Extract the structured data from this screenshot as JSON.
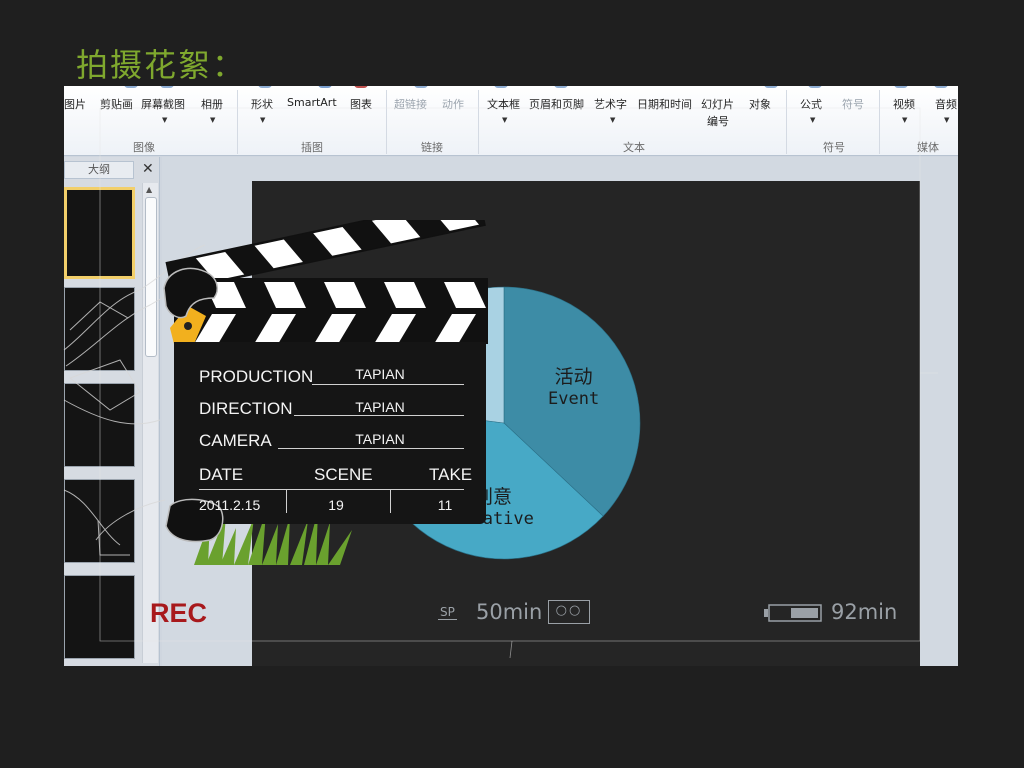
{
  "title": "拍摄花絮：",
  "ribbon": {
    "buttons": [
      {
        "label": "图片",
        "dim": false
      },
      {
        "label": "剪贴画",
        "dim": false
      },
      {
        "label": "屏幕截图",
        "dim": false
      },
      {
        "label": "相册",
        "dim": false
      },
      {
        "label": "形状",
        "dim": false
      },
      {
        "label": "SmartArt",
        "dim": false
      },
      {
        "label": "图表",
        "dim": false
      },
      {
        "label": "超链接",
        "dim": true
      },
      {
        "label": "动作",
        "dim": true
      },
      {
        "label": "文本框",
        "dim": false
      },
      {
        "label": "页眉和页脚",
        "dim": false
      },
      {
        "label": "艺术字",
        "dim": false
      },
      {
        "label": "日期和时间",
        "dim": false
      },
      {
        "label": "幻灯片",
        "dim": false
      },
      {
        "label": "编号",
        "dim": false
      },
      {
        "label": "对象",
        "dim": false
      },
      {
        "label": "公式",
        "dim": false
      },
      {
        "label": "符号",
        "dim": true
      },
      {
        "label": "视频",
        "dim": false
      },
      {
        "label": "音频",
        "dim": false
      }
    ],
    "groups": [
      "图像",
      "插图",
      "链接",
      "文本",
      "符号",
      "媒体"
    ]
  },
  "panel": {
    "tab_label": "大纲",
    "close_glyph": "✕"
  },
  "chart_data": {
    "type": "pie",
    "slices": [
      {
        "label": "活动",
        "label_en": "Event",
        "value": 37,
        "color": "#3d8ca6"
      },
      {
        "label": "创意",
        "label_en": "Creative",
        "value": 40,
        "color": "#47a9c6"
      },
      {
        "label": "",
        "label_en": "",
        "value": 23,
        "color": "#a9d2e3"
      }
    ]
  },
  "clapperboard": {
    "production_label": "PRODUCTION",
    "production_value": "TAPIAN",
    "direction_label": "DIRECTION",
    "direction_value": "TAPIAN",
    "camera_label": "CAMERA",
    "camera_value": "TAPIAN",
    "date_label": "DATE",
    "scene_label": "SCENE",
    "take_label": "TAKE",
    "date_value": "2011.2.15",
    "scene_value": "19",
    "take_value": "11"
  },
  "hud": {
    "rec": "REC",
    "sp": "SP",
    "tape_time": "50min",
    "tape_glyph": "○○",
    "battery_time": "92min",
    "battery_level": 0.35
  },
  "colors": {
    "title": "#7fa82e",
    "rec": "#a8191c",
    "grass": "#6aa12e",
    "hud": "#9aa0a6"
  }
}
